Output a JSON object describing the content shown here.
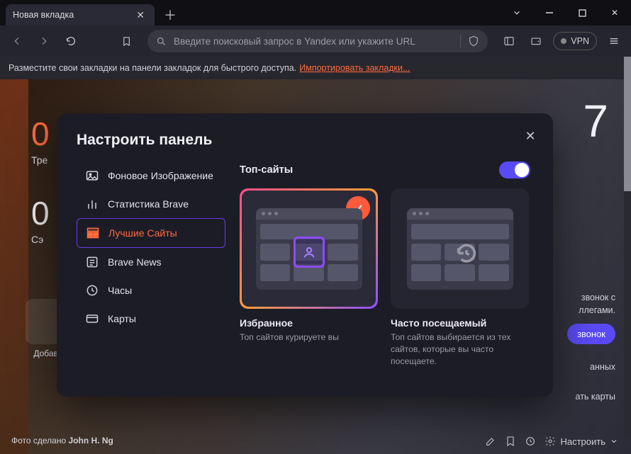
{
  "tab": {
    "title": "Новая вкладка"
  },
  "toolbar": {
    "placeholder": "Введите поисковый запрос в Yandex или укажите URL",
    "vpn_label": "VPN"
  },
  "bookmarks_bar": {
    "prompt": "Разместите свои закладки на панели закладок для быстрого доступа.",
    "import_link": "Импортировать закладки..."
  },
  "ntp": {
    "clock": "7",
    "stat_value": "0",
    "stat_label": "Тре",
    "stat_value2": "0",
    "stat_label2": "Сэ",
    "add_label": "Добави",
    "call_text1": "звонок с",
    "call_text2": "ллегами.",
    "call_button": "звонок",
    "link2": "анных",
    "link3": "ать карты",
    "photo_prefix": "Фото сделано",
    "photo_author": "John H. Ng",
    "customize": "Настроить"
  },
  "modal": {
    "title": "Настроить панель",
    "side": [
      {
        "label": "Фоновое Изображение"
      },
      {
        "label": "Статистика Brave"
      },
      {
        "label": "Лучшие Сайты"
      },
      {
        "label": "Brave News"
      },
      {
        "label": "Часы"
      },
      {
        "label": "Карты"
      }
    ],
    "section_title": "Топ-сайты",
    "card1": {
      "title": "Избранное",
      "desc": "Топ сайтов курируете вы"
    },
    "card2": {
      "title": "Часто посещаемый",
      "desc": "Топ сайтов выбирается из тех сайтов, которые вы часто посещаете."
    }
  }
}
